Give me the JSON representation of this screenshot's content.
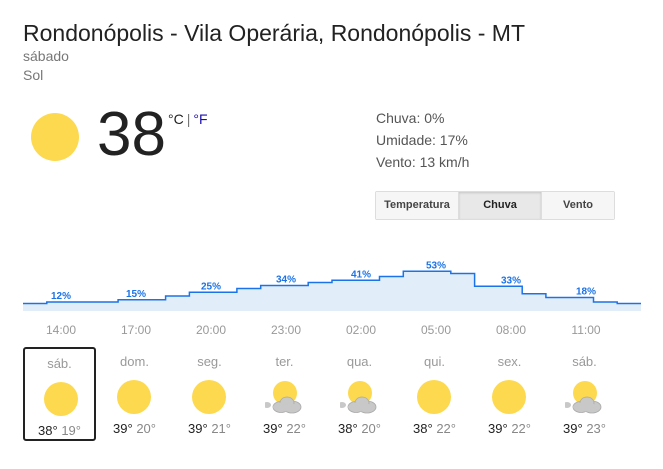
{
  "location": "Rondonópolis - Vila Operária, Rondonópolis - MT",
  "day": "sábado",
  "condition": "Sol",
  "current": {
    "temperature": "38",
    "unit_c": "°C",
    "unit_sep": "|",
    "unit_f": "°F",
    "icon": "sun-icon"
  },
  "details": {
    "chuva": "Chuva: 0%",
    "umidade": "Umidade: 17%",
    "vento": "Vento: 13 km/h"
  },
  "tabs": [
    {
      "label": "Temperatura",
      "active": false
    },
    {
      "label": "Chuva",
      "active": true
    },
    {
      "label": "Vento",
      "active": false
    }
  ],
  "colors": {
    "line": "#1a73e8",
    "fill": "#e1eefa",
    "label": "#1a73e8",
    "sun": "#fcd94f",
    "cloud": "#c8c8c8"
  },
  "chart_data": {
    "type": "area",
    "title": "",
    "xlabel": "",
    "ylabel": "",
    "ylim": [
      0,
      100
    ],
    "x": [
      "14:00",
      "17:00",
      "20:00",
      "23:00",
      "02:00",
      "05:00",
      "08:00",
      "11:00"
    ],
    "values": [
      12,
      15,
      25,
      34,
      41,
      53,
      33,
      18
    ],
    "step_values": [
      10,
      12,
      12,
      12,
      15,
      15,
      20,
      25,
      25,
      30,
      34,
      34,
      38,
      41,
      41,
      46,
      53,
      53,
      50,
      33,
      33,
      23,
      18,
      18,
      12,
      10
    ],
    "labels": [
      "12%",
      "15%",
      "25%",
      "34%",
      "41%",
      "53%",
      "33%",
      "18%"
    ],
    "grid": false
  },
  "forecast": [
    {
      "day": "sáb.",
      "high": "38°",
      "low": "19°",
      "icon": "sun-icon",
      "selected": true
    },
    {
      "day": "dom.",
      "high": "39°",
      "low": "20°",
      "icon": "sun-icon",
      "selected": false
    },
    {
      "day": "seg.",
      "high": "39°",
      "low": "21°",
      "icon": "sun-icon",
      "selected": false
    },
    {
      "day": "ter.",
      "high": "39°",
      "low": "22°",
      "icon": "partly-cloudy-icon",
      "selected": false
    },
    {
      "day": "qua.",
      "high": "38°",
      "low": "20°",
      "icon": "partly-cloudy-icon",
      "selected": false
    },
    {
      "day": "qui.",
      "high": "38°",
      "low": "22°",
      "icon": "sun-icon",
      "selected": false
    },
    {
      "day": "sex.",
      "high": "39°",
      "low": "22°",
      "icon": "sun-icon",
      "selected": false
    },
    {
      "day": "sáb.",
      "high": "39°",
      "low": "23°",
      "icon": "partly-cloudy-icon",
      "selected": false
    }
  ]
}
